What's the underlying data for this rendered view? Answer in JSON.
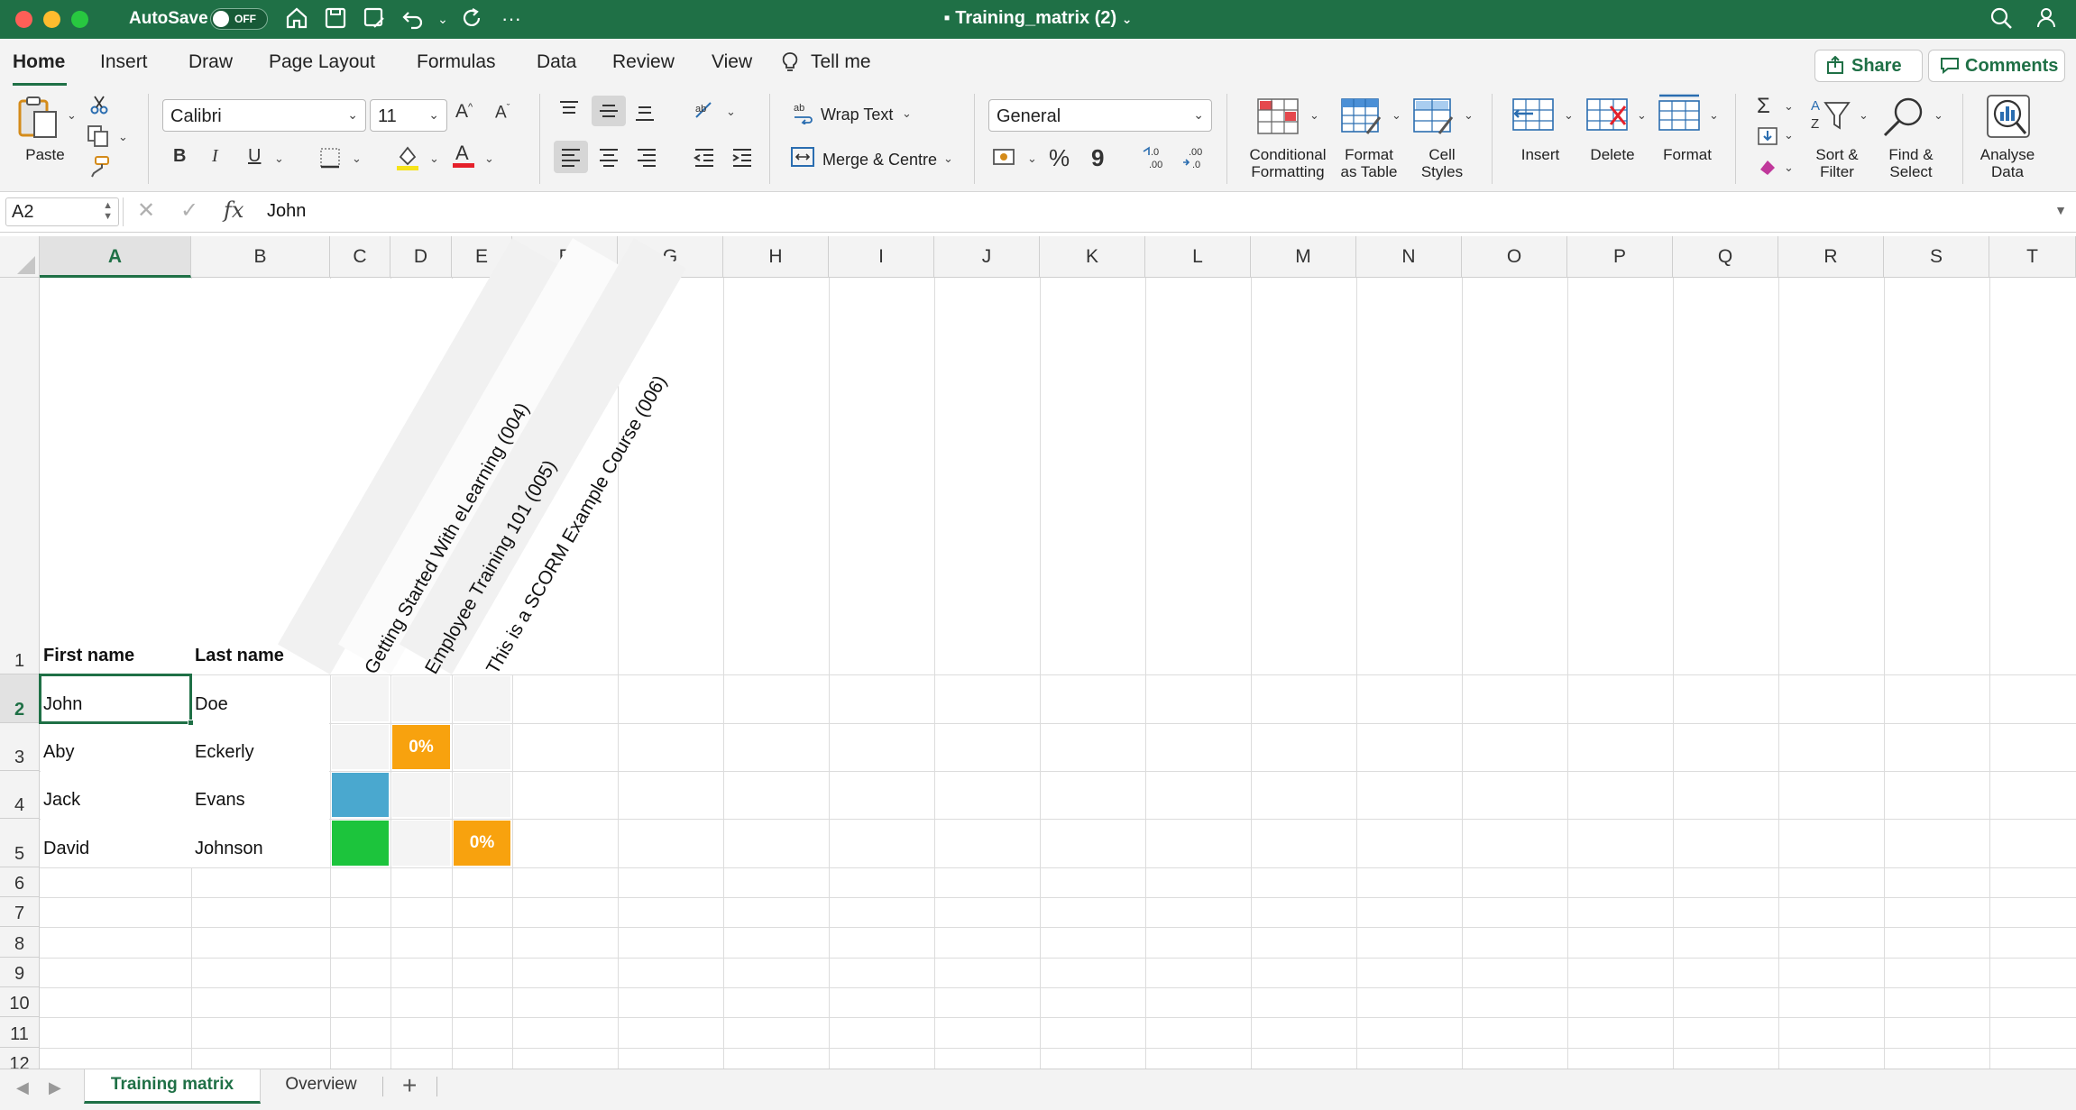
{
  "titlebar": {
    "autosave_label": "AutoSave",
    "autosave_state": "OFF",
    "doc_title": "Training_matrix (2)"
  },
  "ribbon_tabs": [
    "Home",
    "Insert",
    "Draw",
    "Page Layout",
    "Formulas",
    "Data",
    "Review",
    "View",
    "Tell me"
  ],
  "share_label": "Share",
  "comments_label": "Comments",
  "ribbon": {
    "paste": "Paste",
    "font_name": "Calibri",
    "font_size": "11",
    "bold": "B",
    "italic": "I",
    "underline": "U",
    "wrap_text": "Wrap Text",
    "merge_centre": "Merge & Centre",
    "number_format": "General",
    "conditional_formatting": [
      "Conditional",
      "Formatting"
    ],
    "format_as_table": [
      "Format",
      "as Table"
    ],
    "cell_styles": [
      "Cell",
      "Styles"
    ],
    "insert": "Insert",
    "delete": "Delete",
    "format": "Format",
    "sort_filter": [
      "Sort &",
      "Filter"
    ],
    "find_select": [
      "Find &",
      "Select"
    ],
    "analyse_data": [
      "Analyse",
      "Data"
    ],
    "percent": "%",
    "comma": "9"
  },
  "formula_bar": {
    "name_box": "A2",
    "fx": "fx",
    "formula": "John"
  },
  "columns": [
    "A",
    "B",
    "C",
    "D",
    "E",
    "F",
    "G",
    "H",
    "I",
    "J",
    "K",
    "L",
    "M",
    "N",
    "O",
    "P",
    "Q",
    "R",
    "S",
    "T"
  ],
  "rows": [
    "1",
    "2",
    "3",
    "4",
    "5",
    "6",
    "7",
    "8",
    "9",
    "10",
    "11",
    "12"
  ],
  "cells": {
    "A1": "First name",
    "B1": "Last name",
    "C1": "Getting Started With eLearning (004)",
    "D1": "Employee Training 101 (005)",
    "E1": "This is a SCORM Example Course (006)",
    "A2": "John",
    "B2": "Doe",
    "A3": "Aby",
    "B3": "Eckerly",
    "A4": "Jack",
    "B4": "Evans",
    "A5": "David",
    "B5": "Johnson",
    "D3": "0%",
    "E5": "0%"
  },
  "status_colors": {
    "in_progress": "#f8a20e",
    "not_started": "#4aa8cf",
    "completed": "#1cc43c",
    "empty": "#f4f4f4"
  },
  "sheets": [
    "Training matrix",
    "Overview"
  ],
  "add_sheet": "+"
}
